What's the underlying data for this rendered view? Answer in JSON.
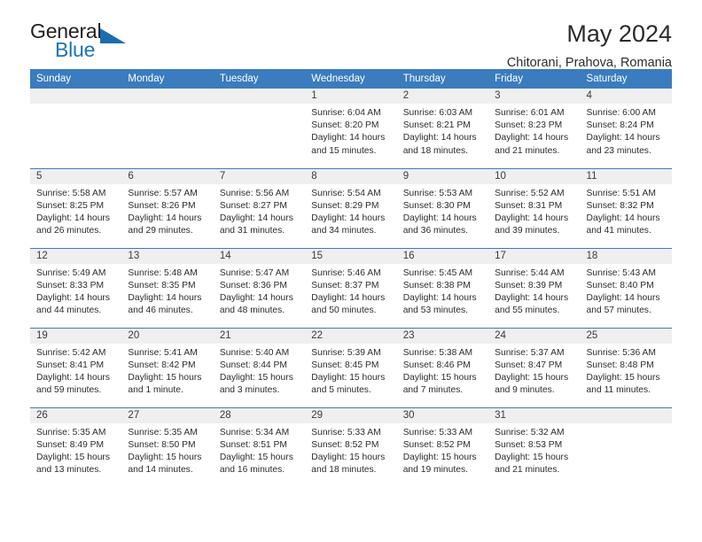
{
  "brand": {
    "name_top": "General",
    "name_bottom": "Blue",
    "accent_color": "#1b6cb0"
  },
  "header": {
    "title": "May 2024",
    "subtitle": "Chitorani, Prahova, Romania"
  },
  "theme": {
    "header_blue": "#3a7cbe",
    "day_band_gray": "#efefef"
  },
  "weekday_headers": [
    "Sunday",
    "Monday",
    "Tuesday",
    "Wednesday",
    "Thursday",
    "Friday",
    "Saturday"
  ],
  "weeks": [
    [
      {
        "day": "",
        "sunrise": "",
        "sunset": "",
        "daylight_line1": "",
        "daylight_line2": ""
      },
      {
        "day": "",
        "sunrise": "",
        "sunset": "",
        "daylight_line1": "",
        "daylight_line2": ""
      },
      {
        "day": "",
        "sunrise": "",
        "sunset": "",
        "daylight_line1": "",
        "daylight_line2": ""
      },
      {
        "day": "1",
        "sunrise": "Sunrise: 6:04 AM",
        "sunset": "Sunset: 8:20 PM",
        "daylight_line1": "Daylight: 14 hours",
        "daylight_line2": "and 15 minutes."
      },
      {
        "day": "2",
        "sunrise": "Sunrise: 6:03 AM",
        "sunset": "Sunset: 8:21 PM",
        "daylight_line1": "Daylight: 14 hours",
        "daylight_line2": "and 18 minutes."
      },
      {
        "day": "3",
        "sunrise": "Sunrise: 6:01 AM",
        "sunset": "Sunset: 8:23 PM",
        "daylight_line1": "Daylight: 14 hours",
        "daylight_line2": "and 21 minutes."
      },
      {
        "day": "4",
        "sunrise": "Sunrise: 6:00 AM",
        "sunset": "Sunset: 8:24 PM",
        "daylight_line1": "Daylight: 14 hours",
        "daylight_line2": "and 23 minutes."
      }
    ],
    [
      {
        "day": "5",
        "sunrise": "Sunrise: 5:58 AM",
        "sunset": "Sunset: 8:25 PM",
        "daylight_line1": "Daylight: 14 hours",
        "daylight_line2": "and 26 minutes."
      },
      {
        "day": "6",
        "sunrise": "Sunrise: 5:57 AM",
        "sunset": "Sunset: 8:26 PM",
        "daylight_line1": "Daylight: 14 hours",
        "daylight_line2": "and 29 minutes."
      },
      {
        "day": "7",
        "sunrise": "Sunrise: 5:56 AM",
        "sunset": "Sunset: 8:27 PM",
        "daylight_line1": "Daylight: 14 hours",
        "daylight_line2": "and 31 minutes."
      },
      {
        "day": "8",
        "sunrise": "Sunrise: 5:54 AM",
        "sunset": "Sunset: 8:29 PM",
        "daylight_line1": "Daylight: 14 hours",
        "daylight_line2": "and 34 minutes."
      },
      {
        "day": "9",
        "sunrise": "Sunrise: 5:53 AM",
        "sunset": "Sunset: 8:30 PM",
        "daylight_line1": "Daylight: 14 hours",
        "daylight_line2": "and 36 minutes."
      },
      {
        "day": "10",
        "sunrise": "Sunrise: 5:52 AM",
        "sunset": "Sunset: 8:31 PM",
        "daylight_line1": "Daylight: 14 hours",
        "daylight_line2": "and 39 minutes."
      },
      {
        "day": "11",
        "sunrise": "Sunrise: 5:51 AM",
        "sunset": "Sunset: 8:32 PM",
        "daylight_line1": "Daylight: 14 hours",
        "daylight_line2": "and 41 minutes."
      }
    ],
    [
      {
        "day": "12",
        "sunrise": "Sunrise: 5:49 AM",
        "sunset": "Sunset: 8:33 PM",
        "daylight_line1": "Daylight: 14 hours",
        "daylight_line2": "and 44 minutes."
      },
      {
        "day": "13",
        "sunrise": "Sunrise: 5:48 AM",
        "sunset": "Sunset: 8:35 PM",
        "daylight_line1": "Daylight: 14 hours",
        "daylight_line2": "and 46 minutes."
      },
      {
        "day": "14",
        "sunrise": "Sunrise: 5:47 AM",
        "sunset": "Sunset: 8:36 PM",
        "daylight_line1": "Daylight: 14 hours",
        "daylight_line2": "and 48 minutes."
      },
      {
        "day": "15",
        "sunrise": "Sunrise: 5:46 AM",
        "sunset": "Sunset: 8:37 PM",
        "daylight_line1": "Daylight: 14 hours",
        "daylight_line2": "and 50 minutes."
      },
      {
        "day": "16",
        "sunrise": "Sunrise: 5:45 AM",
        "sunset": "Sunset: 8:38 PM",
        "daylight_line1": "Daylight: 14 hours",
        "daylight_line2": "and 53 minutes."
      },
      {
        "day": "17",
        "sunrise": "Sunrise: 5:44 AM",
        "sunset": "Sunset: 8:39 PM",
        "daylight_line1": "Daylight: 14 hours",
        "daylight_line2": "and 55 minutes."
      },
      {
        "day": "18",
        "sunrise": "Sunrise: 5:43 AM",
        "sunset": "Sunset: 8:40 PM",
        "daylight_line1": "Daylight: 14 hours",
        "daylight_line2": "and 57 minutes."
      }
    ],
    [
      {
        "day": "19",
        "sunrise": "Sunrise: 5:42 AM",
        "sunset": "Sunset: 8:41 PM",
        "daylight_line1": "Daylight: 14 hours",
        "daylight_line2": "and 59 minutes."
      },
      {
        "day": "20",
        "sunrise": "Sunrise: 5:41 AM",
        "sunset": "Sunset: 8:42 PM",
        "daylight_line1": "Daylight: 15 hours",
        "daylight_line2": "and 1 minute."
      },
      {
        "day": "21",
        "sunrise": "Sunrise: 5:40 AM",
        "sunset": "Sunset: 8:44 PM",
        "daylight_line1": "Daylight: 15 hours",
        "daylight_line2": "and 3 minutes."
      },
      {
        "day": "22",
        "sunrise": "Sunrise: 5:39 AM",
        "sunset": "Sunset: 8:45 PM",
        "daylight_line1": "Daylight: 15 hours",
        "daylight_line2": "and 5 minutes."
      },
      {
        "day": "23",
        "sunrise": "Sunrise: 5:38 AM",
        "sunset": "Sunset: 8:46 PM",
        "daylight_line1": "Daylight: 15 hours",
        "daylight_line2": "and 7 minutes."
      },
      {
        "day": "24",
        "sunrise": "Sunrise: 5:37 AM",
        "sunset": "Sunset: 8:47 PM",
        "daylight_line1": "Daylight: 15 hours",
        "daylight_line2": "and 9 minutes."
      },
      {
        "day": "25",
        "sunrise": "Sunrise: 5:36 AM",
        "sunset": "Sunset: 8:48 PM",
        "daylight_line1": "Daylight: 15 hours",
        "daylight_line2": "and 11 minutes."
      }
    ],
    [
      {
        "day": "26",
        "sunrise": "Sunrise: 5:35 AM",
        "sunset": "Sunset: 8:49 PM",
        "daylight_line1": "Daylight: 15 hours",
        "daylight_line2": "and 13 minutes."
      },
      {
        "day": "27",
        "sunrise": "Sunrise: 5:35 AM",
        "sunset": "Sunset: 8:50 PM",
        "daylight_line1": "Daylight: 15 hours",
        "daylight_line2": "and 14 minutes."
      },
      {
        "day": "28",
        "sunrise": "Sunrise: 5:34 AM",
        "sunset": "Sunset: 8:51 PM",
        "daylight_line1": "Daylight: 15 hours",
        "daylight_line2": "and 16 minutes."
      },
      {
        "day": "29",
        "sunrise": "Sunrise: 5:33 AM",
        "sunset": "Sunset: 8:52 PM",
        "daylight_line1": "Daylight: 15 hours",
        "daylight_line2": "and 18 minutes."
      },
      {
        "day": "30",
        "sunrise": "Sunrise: 5:33 AM",
        "sunset": "Sunset: 8:52 PM",
        "daylight_line1": "Daylight: 15 hours",
        "daylight_line2": "and 19 minutes."
      },
      {
        "day": "31",
        "sunrise": "Sunrise: 5:32 AM",
        "sunset": "Sunset: 8:53 PM",
        "daylight_line1": "Daylight: 15 hours",
        "daylight_line2": "and 21 minutes."
      },
      {
        "day": "",
        "sunrise": "",
        "sunset": "",
        "daylight_line1": "",
        "daylight_line2": ""
      }
    ]
  ]
}
